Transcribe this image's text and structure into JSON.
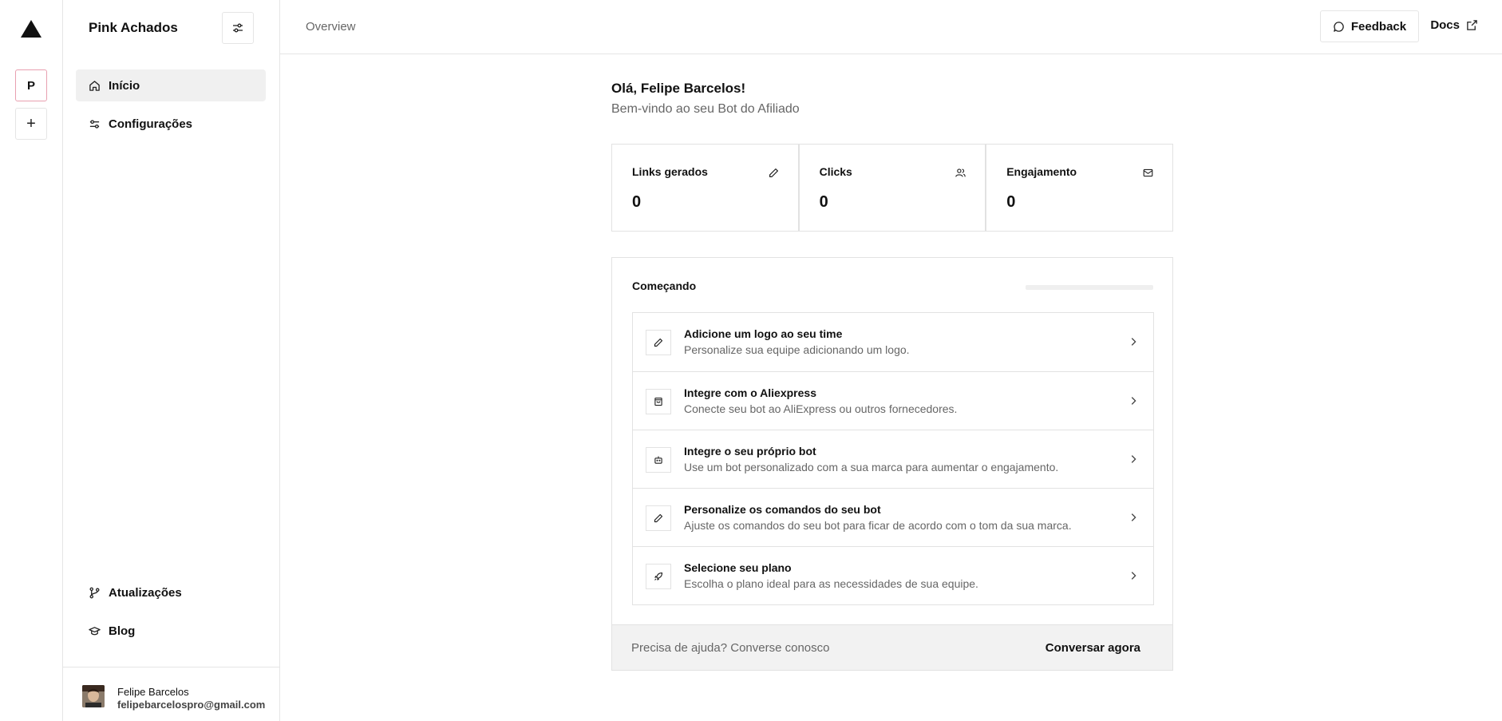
{
  "rail": {
    "team_initial": "P",
    "add_label": "+"
  },
  "sidebar": {
    "title": "Pink Achados",
    "nav_top": [
      {
        "label": "Início",
        "icon": "home-icon",
        "active": true
      },
      {
        "label": "Configurações",
        "icon": "sliders-icon",
        "active": false
      }
    ],
    "nav_bottom": [
      {
        "label": "Atualizações",
        "icon": "git-branch-icon"
      },
      {
        "label": "Blog",
        "icon": "graduation-cap-icon"
      }
    ],
    "user": {
      "name": "Felipe Barcelos",
      "email": "felipebarcelospro@gmail.com"
    }
  },
  "topbar": {
    "breadcrumb": "Overview",
    "feedback_label": "Feedback",
    "docs_label": "Docs"
  },
  "main": {
    "greeting": "Olá, Felipe Barcelos!",
    "subtitle": "Bem-vindo ao seu Bot do Afiliado",
    "stats": [
      {
        "label": "Links gerados",
        "value": "0",
        "icon": "pencil-icon"
      },
      {
        "label": "Clicks",
        "value": "0",
        "icon": "users-icon"
      },
      {
        "label": "Engajamento",
        "value": "0",
        "icon": "mail-icon"
      }
    ],
    "getting_started": {
      "title": "Começando",
      "progress": 0,
      "items": [
        {
          "title": "Adicione um logo ao seu time",
          "desc": "Personalize sua equipe adicionando um logo.",
          "icon": "pencil-icon"
        },
        {
          "title": "Integre com o Aliexpress",
          "desc": "Conecte seu bot ao AliExpress ou outros fornecedores.",
          "icon": "shopping-bag-icon"
        },
        {
          "title": "Integre o seu próprio bot",
          "desc": "Use um bot personalizado com a sua marca para aumentar o engajamento.",
          "icon": "bot-icon"
        },
        {
          "title": "Personalize os comandos do seu bot",
          "desc": "Ajuste os comandos do seu bot para ficar de acordo com o tom da sua marca.",
          "icon": "pencil-icon"
        },
        {
          "title": "Selecione seu plano",
          "desc": "Escolha o plano ideal para as necessidades de sua equipe.",
          "icon": "rocket-icon"
        }
      ],
      "help_text": "Precisa de ajuda? Converse conosco",
      "chat_label": "Conversar agora"
    }
  }
}
